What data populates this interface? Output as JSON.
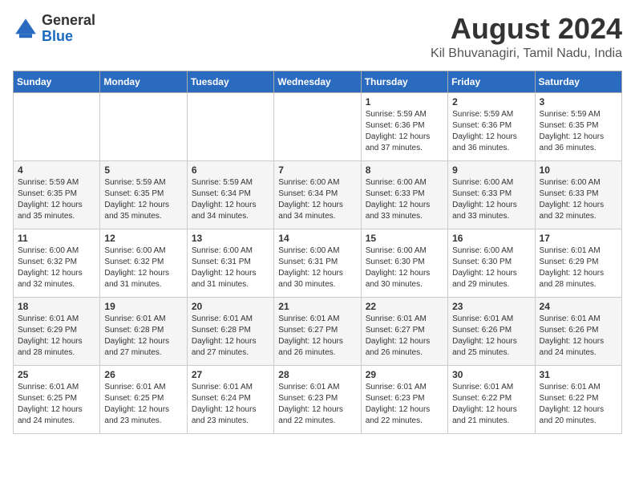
{
  "logo": {
    "general": "General",
    "blue": "Blue"
  },
  "title": "August 2024",
  "location": "Kil Bhuvanagiri, Tamil Nadu, India",
  "days_header": [
    "Sunday",
    "Monday",
    "Tuesday",
    "Wednesday",
    "Thursday",
    "Friday",
    "Saturday"
  ],
  "weeks": [
    [
      {
        "day": "",
        "info": ""
      },
      {
        "day": "",
        "info": ""
      },
      {
        "day": "",
        "info": ""
      },
      {
        "day": "",
        "info": ""
      },
      {
        "day": "1",
        "info": "Sunrise: 5:59 AM\nSunset: 6:36 PM\nDaylight: 12 hours\nand 37 minutes."
      },
      {
        "day": "2",
        "info": "Sunrise: 5:59 AM\nSunset: 6:36 PM\nDaylight: 12 hours\nand 36 minutes."
      },
      {
        "day": "3",
        "info": "Sunrise: 5:59 AM\nSunset: 6:35 PM\nDaylight: 12 hours\nand 36 minutes."
      }
    ],
    [
      {
        "day": "4",
        "info": "Sunrise: 5:59 AM\nSunset: 6:35 PM\nDaylight: 12 hours\nand 35 minutes."
      },
      {
        "day": "5",
        "info": "Sunrise: 5:59 AM\nSunset: 6:35 PM\nDaylight: 12 hours\nand 35 minutes."
      },
      {
        "day": "6",
        "info": "Sunrise: 5:59 AM\nSunset: 6:34 PM\nDaylight: 12 hours\nand 34 minutes."
      },
      {
        "day": "7",
        "info": "Sunrise: 6:00 AM\nSunset: 6:34 PM\nDaylight: 12 hours\nand 34 minutes."
      },
      {
        "day": "8",
        "info": "Sunrise: 6:00 AM\nSunset: 6:33 PM\nDaylight: 12 hours\nand 33 minutes."
      },
      {
        "day": "9",
        "info": "Sunrise: 6:00 AM\nSunset: 6:33 PM\nDaylight: 12 hours\nand 33 minutes."
      },
      {
        "day": "10",
        "info": "Sunrise: 6:00 AM\nSunset: 6:33 PM\nDaylight: 12 hours\nand 32 minutes."
      }
    ],
    [
      {
        "day": "11",
        "info": "Sunrise: 6:00 AM\nSunset: 6:32 PM\nDaylight: 12 hours\nand 32 minutes."
      },
      {
        "day": "12",
        "info": "Sunrise: 6:00 AM\nSunset: 6:32 PM\nDaylight: 12 hours\nand 31 minutes."
      },
      {
        "day": "13",
        "info": "Sunrise: 6:00 AM\nSunset: 6:31 PM\nDaylight: 12 hours\nand 31 minutes."
      },
      {
        "day": "14",
        "info": "Sunrise: 6:00 AM\nSunset: 6:31 PM\nDaylight: 12 hours\nand 30 minutes."
      },
      {
        "day": "15",
        "info": "Sunrise: 6:00 AM\nSunset: 6:30 PM\nDaylight: 12 hours\nand 30 minutes."
      },
      {
        "day": "16",
        "info": "Sunrise: 6:00 AM\nSunset: 6:30 PM\nDaylight: 12 hours\nand 29 minutes."
      },
      {
        "day": "17",
        "info": "Sunrise: 6:01 AM\nSunset: 6:29 PM\nDaylight: 12 hours\nand 28 minutes."
      }
    ],
    [
      {
        "day": "18",
        "info": "Sunrise: 6:01 AM\nSunset: 6:29 PM\nDaylight: 12 hours\nand 28 minutes."
      },
      {
        "day": "19",
        "info": "Sunrise: 6:01 AM\nSunset: 6:28 PM\nDaylight: 12 hours\nand 27 minutes."
      },
      {
        "day": "20",
        "info": "Sunrise: 6:01 AM\nSunset: 6:28 PM\nDaylight: 12 hours\nand 27 minutes."
      },
      {
        "day": "21",
        "info": "Sunrise: 6:01 AM\nSunset: 6:27 PM\nDaylight: 12 hours\nand 26 minutes."
      },
      {
        "day": "22",
        "info": "Sunrise: 6:01 AM\nSunset: 6:27 PM\nDaylight: 12 hours\nand 26 minutes."
      },
      {
        "day": "23",
        "info": "Sunrise: 6:01 AM\nSunset: 6:26 PM\nDaylight: 12 hours\nand 25 minutes."
      },
      {
        "day": "24",
        "info": "Sunrise: 6:01 AM\nSunset: 6:26 PM\nDaylight: 12 hours\nand 24 minutes."
      }
    ],
    [
      {
        "day": "25",
        "info": "Sunrise: 6:01 AM\nSunset: 6:25 PM\nDaylight: 12 hours\nand 24 minutes."
      },
      {
        "day": "26",
        "info": "Sunrise: 6:01 AM\nSunset: 6:25 PM\nDaylight: 12 hours\nand 23 minutes."
      },
      {
        "day": "27",
        "info": "Sunrise: 6:01 AM\nSunset: 6:24 PM\nDaylight: 12 hours\nand 23 minutes."
      },
      {
        "day": "28",
        "info": "Sunrise: 6:01 AM\nSunset: 6:23 PM\nDaylight: 12 hours\nand 22 minutes."
      },
      {
        "day": "29",
        "info": "Sunrise: 6:01 AM\nSunset: 6:23 PM\nDaylight: 12 hours\nand 22 minutes."
      },
      {
        "day": "30",
        "info": "Sunrise: 6:01 AM\nSunset: 6:22 PM\nDaylight: 12 hours\nand 21 minutes."
      },
      {
        "day": "31",
        "info": "Sunrise: 6:01 AM\nSunset: 6:22 PM\nDaylight: 12 hours\nand 20 minutes."
      }
    ]
  ]
}
